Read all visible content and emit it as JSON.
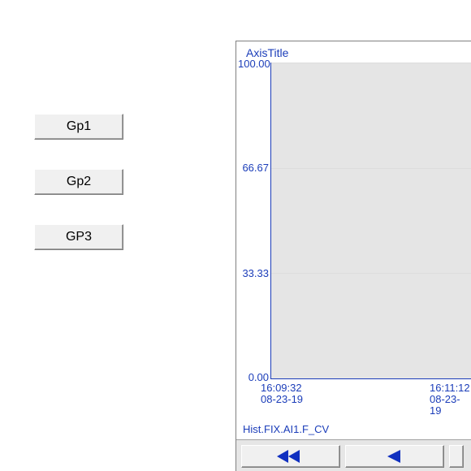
{
  "buttons": {
    "gp1": "Gp1",
    "gp2": "Gp2",
    "gp3": "GP3"
  },
  "chart": {
    "axis_title": "AxisTitle",
    "y_ticks": [
      "100.00",
      "66.67",
      "33.33",
      "0.00"
    ],
    "x_ticks": [
      {
        "time": "16:09:32",
        "date": "08-23-19"
      },
      {
        "time": "16:11:12",
        "date": "08-23-19"
      }
    ],
    "status": "Hist.FIX.AI1.F_CV"
  },
  "chart_data": {
    "type": "line",
    "title": "AxisTitle",
    "xlabel": "",
    "ylabel": "",
    "ylim": [
      0,
      100
    ],
    "x": [
      "16:09:32 08-23-19",
      "16:11:12 08-23-19"
    ],
    "series": [
      {
        "name": "Hist.FIX.AI1.F_CV",
        "values": [
          0,
          0
        ]
      }
    ]
  }
}
